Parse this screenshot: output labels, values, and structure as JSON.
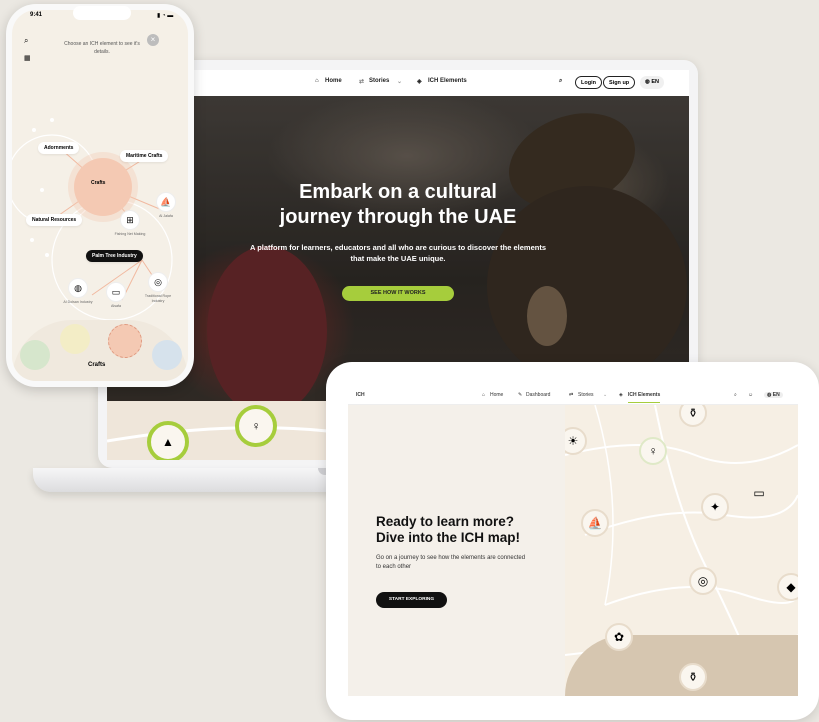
{
  "laptop": {
    "nav": {
      "home": "Home",
      "stories": "Stories",
      "ich_elements": "ICH Elements",
      "login": "Login",
      "signup": "Sign up",
      "lang": "EN"
    },
    "hero": {
      "title_line1": "Embark on a cultural",
      "title_line2": "journey through the UAE",
      "subtitle": "A platform for learners, educators and all who are curious to discover the elements that make the UAE unique.",
      "cta": "SEE HOW IT WORKS"
    }
  },
  "tablet": {
    "nav": {
      "brand": "ICH",
      "home": "Home",
      "dashboard": "Dashboard",
      "stories": "Stories",
      "ich_elements": "ICH Elements",
      "lang": "EN"
    },
    "heading_line1": "Ready to learn more?",
    "heading_line2": "Dive into the ICH map!",
    "description": "Go on a journey to see how the elements are connected to each other",
    "cta": "START EXPLORING"
  },
  "phone": {
    "time": "9:41",
    "prompt": "Choose an ICH element to see it's details.",
    "nodes": {
      "adornments": "Adornments",
      "maritime": "Maritime Crafts",
      "crafts": "Crafts",
      "natural": "Natural Resources",
      "palm": "Palm Tree Industry",
      "fishing_net": "Fishing Net Making",
      "al_jalafa": "Al Jalafa",
      "al_dolsan": "Al Dolsan Industry",
      "al_safa": "Alsafa",
      "traditional_rope": "Traditional Rope Industry"
    },
    "bottom_label": "Crafts"
  },
  "colors": {
    "accent_green": "#a6cd3c",
    "background": "#ebe8e2",
    "crafts_bubble": "#f4c9b3"
  }
}
